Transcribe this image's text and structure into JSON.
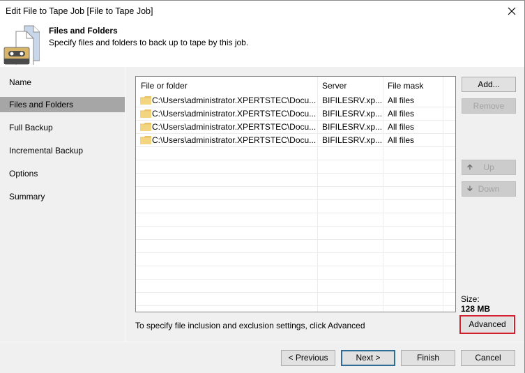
{
  "window": {
    "title": "Edit File to Tape Job [File to Tape Job]",
    "close_icon": "close-icon"
  },
  "header": {
    "icon": "files-tape-icon",
    "title": "Files and Folders",
    "subtitle": "Specify files and folders to back up to tape by this job."
  },
  "nav": {
    "items": [
      {
        "label": "Name",
        "active": false
      },
      {
        "label": "Files and Folders",
        "active": true
      },
      {
        "label": "Full Backup",
        "active": false
      },
      {
        "label": "Incremental Backup",
        "active": false
      },
      {
        "label": "Options",
        "active": false
      },
      {
        "label": "Summary",
        "active": false
      }
    ]
  },
  "table": {
    "columns": [
      "File or folder",
      "Server",
      "File mask"
    ],
    "rows": [
      {
        "icon": "folder-icon",
        "path": "C:\\Users\\administrator.XPERTSTEC\\Docu...",
        "server": "BIFILESRV.xp...",
        "mask": "All files"
      },
      {
        "icon": "folder-icon",
        "path": "C:\\Users\\administrator.XPERTSTEC\\Docu...",
        "server": "BIFILESRV.xp...",
        "mask": "All files"
      },
      {
        "icon": "folder-icon",
        "path": "C:\\Users\\administrator.XPERTSTEC\\Docu...",
        "server": "BIFILESRV.xp...",
        "mask": "All files"
      },
      {
        "icon": "folder-icon",
        "path": "C:\\Users\\administrator.XPERTSTEC\\Docu...",
        "server": "BIFILESRV.xp...",
        "mask": "All files"
      }
    ]
  },
  "buttons": {
    "add": "Add...",
    "remove": "Remove",
    "up": "Up",
    "down": "Down",
    "advanced": "Advanced"
  },
  "size": {
    "label": "Size:",
    "value": "128 MB"
  },
  "hint": "To specify file inclusion and exclusion settings, click Advanced",
  "footer": {
    "previous": "< Previous",
    "next": "Next >",
    "finish": "Finish",
    "cancel": "Cancel"
  },
  "colors": {
    "highlight_border": "#d0202e",
    "nav_active": "#a6a6a6",
    "default_button_border": "#2f6d94",
    "folder": "#e8c36a"
  }
}
